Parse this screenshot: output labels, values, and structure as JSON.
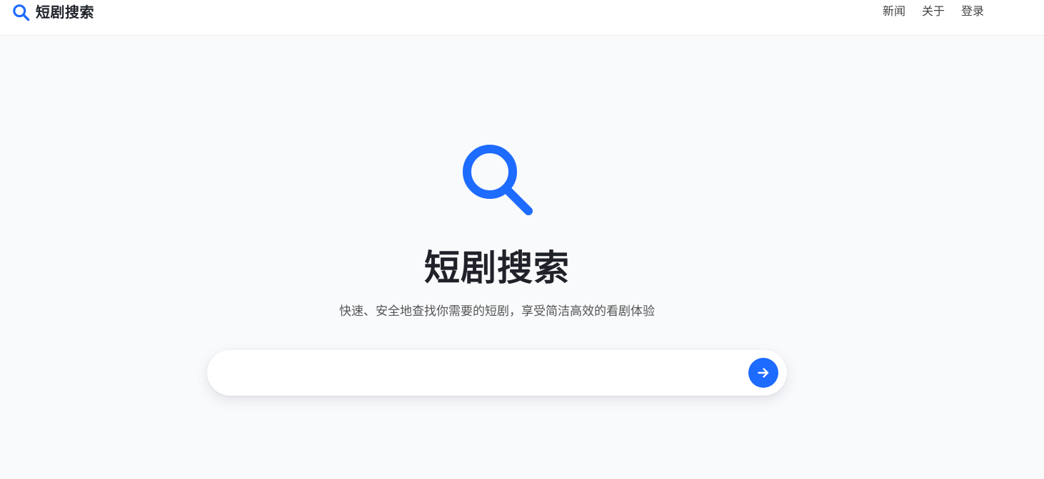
{
  "brand": {
    "title": "短剧搜索",
    "icon": "search-icon",
    "accent_color": "#1e6bff"
  },
  "nav": {
    "items": [
      {
        "label": "新闻"
      },
      {
        "label": "关于"
      },
      {
        "label": "登录"
      }
    ]
  },
  "hero": {
    "icon": "search-icon",
    "title": "短剧搜索",
    "subtitle": "快速、安全地查找你需要的短剧，享受简洁高效的看剧体验"
  },
  "search": {
    "value": "",
    "placeholder": "",
    "submit_icon": "arrow-right-icon"
  }
}
